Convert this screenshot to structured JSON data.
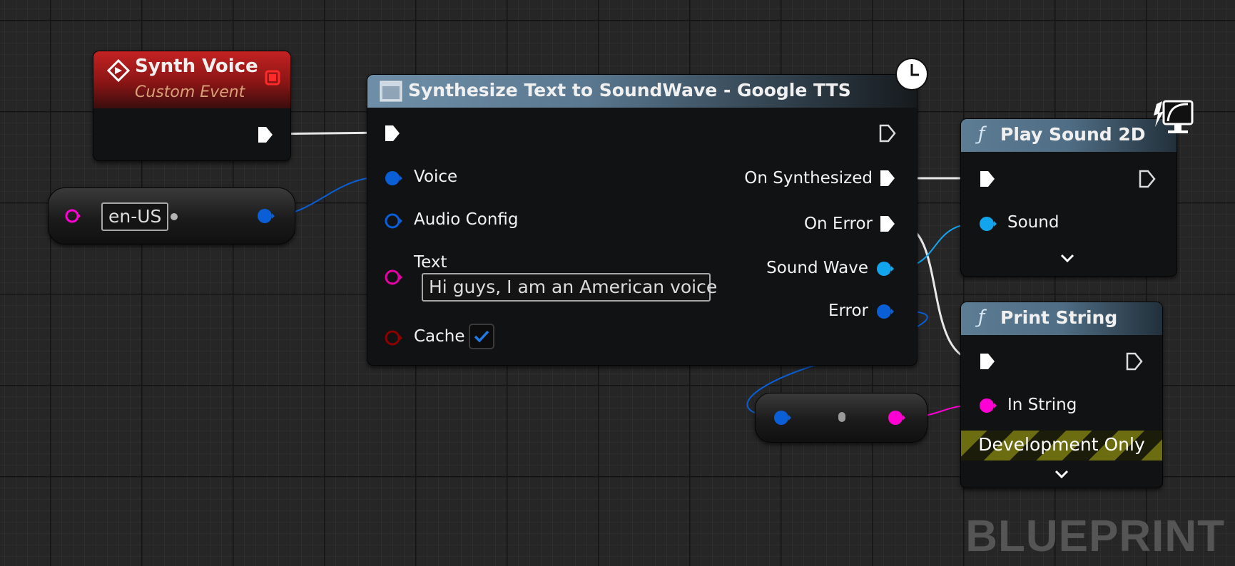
{
  "graph": {
    "watermark": "BLUEPRINT"
  },
  "event_node": {
    "title": "Synth Voice",
    "subtitle": "Custom Event"
  },
  "voice_literal": {
    "value": "en-US"
  },
  "synth_node": {
    "title": "Synthesize Text to SoundWave - Google TTS",
    "inputs": {
      "voice": "Voice",
      "audio_config": "Audio Config",
      "text": "Text",
      "cache": "Cache"
    },
    "text_value": "Hi guys, I am an American voice",
    "cache_checked": true,
    "outputs": {
      "on_synthesized": "On Synthesized",
      "on_error": "On Error",
      "sound_wave": "Sound Wave",
      "error": "Error"
    }
  },
  "play_sound_node": {
    "title": "Play Sound 2D",
    "inputs": {
      "sound": "Sound"
    }
  },
  "print_string_node": {
    "title": "Print String",
    "inputs": {
      "in_string": "In String"
    },
    "banner": "Development Only"
  },
  "colors": {
    "exec": "#ffffff",
    "struct_blue": "#0a5fd6",
    "object_cyan": "#12a5ee",
    "string_magenta": "#ff00d4",
    "text_pink": "#e400a4",
    "bool_red": "#8c0000",
    "event_header": "#b81c1c",
    "function_header": "#5d7d95"
  }
}
